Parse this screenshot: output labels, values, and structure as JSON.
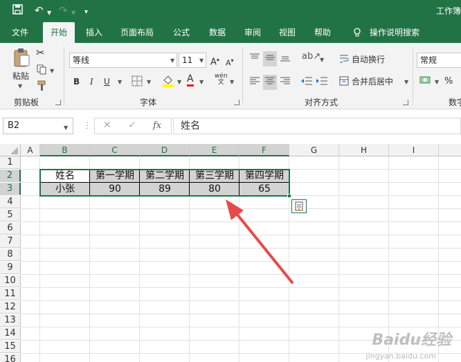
{
  "title_bar": {
    "title": "工作簿"
  },
  "tabs": [
    "文件",
    "开始",
    "插入",
    "页面布局",
    "公式",
    "数据",
    "审阅",
    "视图",
    "帮助",
    "操作说明搜索"
  ],
  "clipboard": {
    "paste_label": "粘贴",
    "group_label": "剪贴板"
  },
  "font": {
    "name": "等线",
    "size": "11",
    "bold": "B",
    "italic": "I",
    "underline": "U",
    "font_color_glyph": "A",
    "phonetic_glyph": "wén",
    "group_label": "字体"
  },
  "alignment": {
    "wrap_label": "自动换行",
    "merge_label": "合并后居中",
    "group_label": "对齐方式"
  },
  "number": {
    "format": "常规",
    "percent": "%",
    "group_label": "数字"
  },
  "formula_bar": {
    "name_box": "B2",
    "fx": "fx",
    "content": "姓名"
  },
  "columns": [
    "A",
    "B",
    "C",
    "D",
    "E",
    "F",
    "G",
    "H",
    "I"
  ],
  "rows": [
    "1",
    "2",
    "3",
    "4",
    "5",
    "6",
    "7",
    "8",
    "9",
    "10",
    "11",
    "12",
    "13",
    "14",
    "15",
    "16"
  ],
  "table": {
    "header": [
      "姓名",
      "第一学期",
      "第二学期",
      "第三学期",
      "第四学期"
    ],
    "row": [
      "小张",
      "90",
      "89",
      "80",
      "65"
    ]
  },
  "watermark": {
    "main": "Baidu经验",
    "sub": "jingyan.baidu.com"
  },
  "colors": {
    "accent": "#217346",
    "arrow": "#e8494a",
    "selection_fill": "#d3d3d3"
  }
}
